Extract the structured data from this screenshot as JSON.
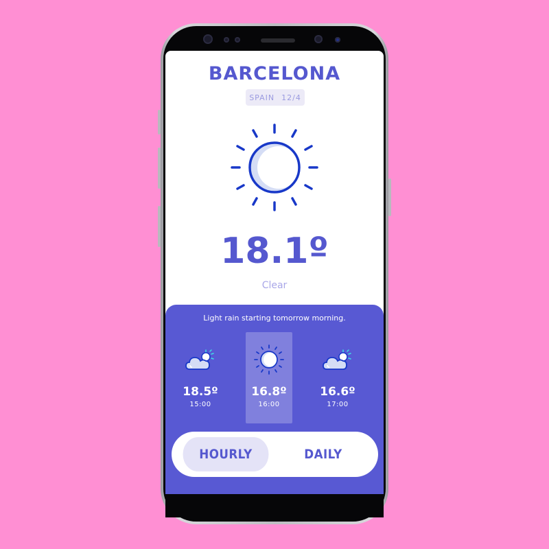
{
  "location": {
    "city": "BARCELONA",
    "country": "SPAIN",
    "date": "12/4"
  },
  "current": {
    "temperature": "18.1º",
    "condition": "Clear",
    "icon": "sun-icon"
  },
  "forecast": {
    "note": "Light rain starting tomorrow morning.",
    "hours": [
      {
        "temp": "18.5º",
        "time": "15:00",
        "icon": "partly-cloudy-icon"
      },
      {
        "temp": "16.8º",
        "time": "16:00",
        "icon": "sun-icon",
        "selected": true
      },
      {
        "temp": "16.6º",
        "time": "17:00",
        "icon": "partly-cloudy-icon"
      }
    ]
  },
  "toggle": {
    "hourly": "HOURLY",
    "daily": "DAILY",
    "active": "HOURLY"
  },
  "colors": {
    "background": "#ff8fd3",
    "accent": "#5558cf",
    "panel": "#5859d3",
    "sun_ring": "#1838c8"
  }
}
